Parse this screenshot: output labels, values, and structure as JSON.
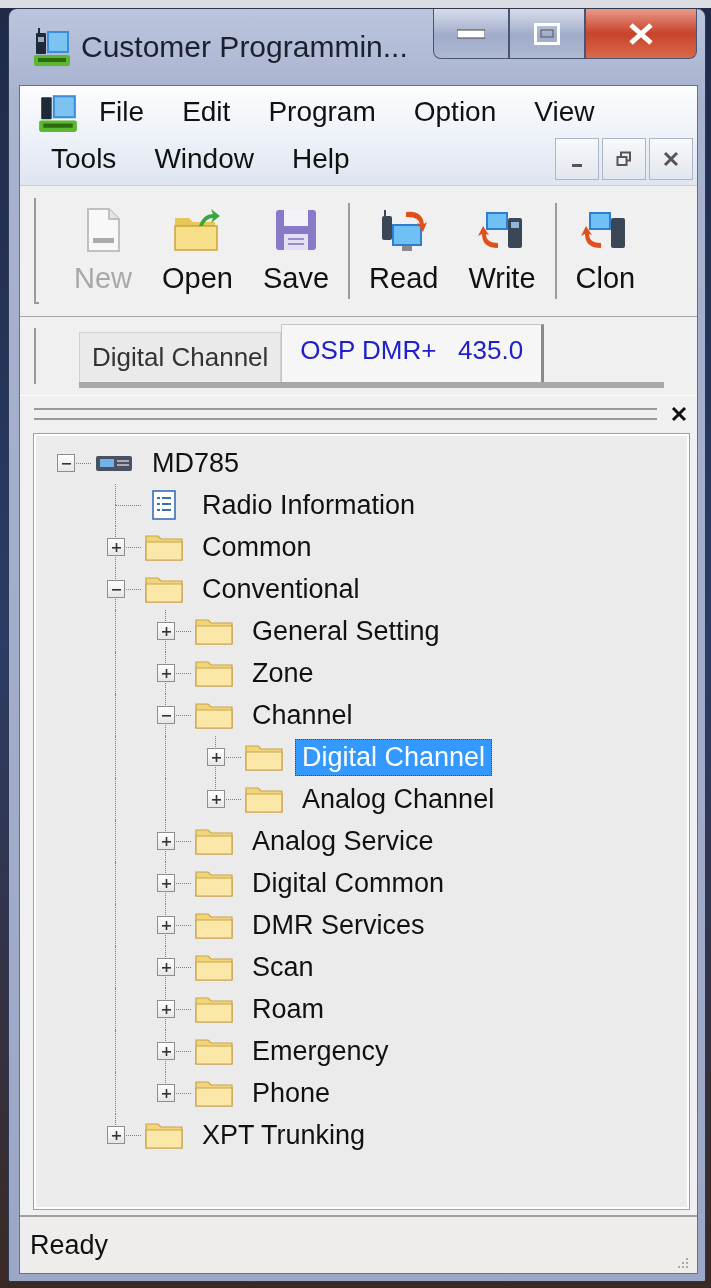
{
  "window": {
    "title": "Customer Programmin..."
  },
  "menu": [
    {
      "label": "File"
    },
    {
      "label": "Edit"
    },
    {
      "label": "Program"
    },
    {
      "label": "Option"
    },
    {
      "label": "View"
    },
    {
      "label": "Tools"
    },
    {
      "label": "Window"
    },
    {
      "label": "Help"
    }
  ],
  "toolbar": [
    [
      {
        "kind": "new",
        "label": "New",
        "disabled": true
      },
      {
        "kind": "open",
        "label": "Open",
        "disabled": false
      },
      {
        "kind": "save",
        "label": "Save",
        "disabled": false
      }
    ],
    [
      {
        "kind": "read",
        "label": "Read",
        "disabled": false
      },
      {
        "kind": "write",
        "label": "Write",
        "disabled": false
      }
    ],
    [
      {
        "kind": "clone",
        "label": "Clon",
        "disabled": false
      }
    ]
  ],
  "tabs": [
    {
      "label": "Digital Channel",
      "selected": false
    },
    {
      "label": "OSP DMR+   435.0",
      "selected": true
    }
  ],
  "tree": [
    {
      "label": "MD785",
      "kind": "device",
      "expanded": true,
      "selected": false,
      "children": [
        {
          "label": "Radio Information",
          "kind": "document",
          "selected": false
        },
        {
          "label": "Common",
          "kind": "folder",
          "expanded": false,
          "selected": false
        },
        {
          "label": "Conventional",
          "kind": "folder",
          "expanded": true,
          "selected": false,
          "children": [
            {
              "label": "General Setting",
              "kind": "folder",
              "expanded": false,
              "selected": false
            },
            {
              "label": "Zone",
              "kind": "folder",
              "expanded": false,
              "selected": false
            },
            {
              "label": "Channel",
              "kind": "folder",
              "expanded": true,
              "selected": false,
              "children": [
                {
                  "label": "Digital Channel",
                  "kind": "folder",
                  "expanded": false,
                  "selected": true
                },
                {
                  "label": "Analog Channel",
                  "kind": "folder",
                  "expanded": false,
                  "selected": false
                }
              ]
            },
            {
              "label": "Analog Service",
              "kind": "folder",
              "expanded": false,
              "selected": false
            },
            {
              "label": "Digital Common",
              "kind": "folder",
              "expanded": false,
              "selected": false
            },
            {
              "label": "DMR Services",
              "kind": "folder",
              "expanded": false,
              "selected": false
            },
            {
              "label": "Scan",
              "kind": "folder",
              "expanded": false,
              "selected": false
            },
            {
              "label": "Roam",
              "kind": "folder",
              "expanded": false,
              "selected": false
            },
            {
              "label": "Emergency",
              "kind": "folder",
              "expanded": false,
              "selected": false
            },
            {
              "label": "Phone",
              "kind": "folder",
              "expanded": false,
              "selected": false
            }
          ]
        },
        {
          "label": "XPT Trunking",
          "kind": "folder",
          "expanded": false,
          "selected": false
        }
      ]
    }
  ],
  "status_bar": {
    "text": "Ready"
  }
}
